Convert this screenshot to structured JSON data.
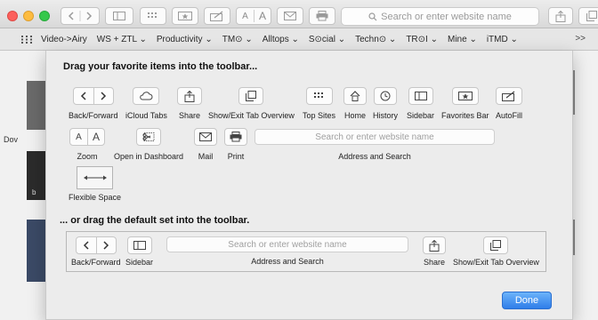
{
  "toolbar": {
    "search_placeholder": "Search or enter website name"
  },
  "favorites": {
    "items": [
      "Video->Airy",
      "WS + ZTL ⌄",
      "Productivity ⌄",
      "TM⊙ ⌄",
      "Alltops ⌄",
      "S⊙cial ⌄",
      "Techn⊙ ⌄",
      "TR⊙I ⌄",
      "Mine ⌄",
      "iTMD ⌄"
    ],
    "overflow": ">>"
  },
  "background": {
    "fragment_1": "Dov",
    "fragment_2": "b"
  },
  "sheet": {
    "heading_drag": "Drag your favorite items into the toolbar...",
    "heading_default": "... or drag the default set into the toolbar.",
    "items": {
      "back_forward": "Back/Forward",
      "icloud_tabs": "iCloud Tabs",
      "share": "Share",
      "show_exit_tab_overview": "Show/Exit Tab Overview",
      "top_sites": "Top Sites",
      "home": "Home",
      "history": "History",
      "sidebar": "Sidebar",
      "favorites_bar": "Favorites Bar",
      "autofill": "AutoFill",
      "zoom": "Zoom",
      "open_in_dashboard": "Open in Dashboard",
      "mail": "Mail",
      "print": "Print",
      "address_and_search": "Address and Search",
      "flexible_space": "Flexible Space",
      "zoom_small": "A",
      "zoom_large": "A"
    },
    "address_placeholder": "Search or enter website name",
    "default_set": {
      "back_forward": "Back/Forward",
      "sidebar": "Sidebar",
      "address_and_search": "Address and Search",
      "share": "Share",
      "show_exit_tab_overview": "Show/Exit Tab Overview",
      "address_placeholder": "Search or enter website name"
    },
    "done_label": "Done"
  }
}
